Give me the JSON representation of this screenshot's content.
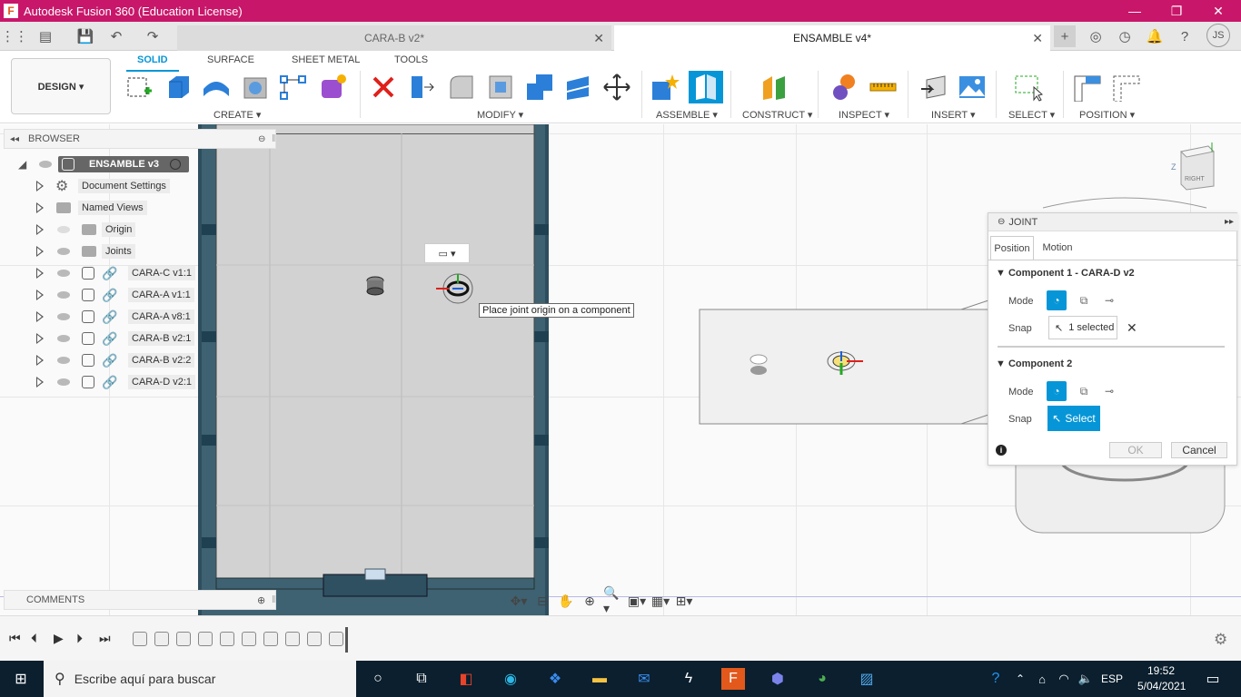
{
  "window": {
    "app_letter": "F",
    "title": "Autodesk Fusion 360 (Education License)"
  },
  "tabs": [
    {
      "label": "CARA-B v2*"
    },
    {
      "label": "ENSAMBLE v4*"
    }
  ],
  "user_initials": "JS",
  "ribbon": {
    "design_label": "DESIGN ▾",
    "tabs": [
      "SOLID",
      "SURFACE",
      "SHEET METAL",
      "TOOLS"
    ],
    "groups": {
      "create": "CREATE ▾",
      "modify": "MODIFY ▾",
      "assemble": "ASSEMBLE ▾",
      "construct": "CONSTRUCT ▾",
      "inspect": "INSPECT ▾",
      "insert": "INSERT ▾",
      "select": "SELECT ▾",
      "position": "POSITION ▾"
    }
  },
  "browser": {
    "title": "BROWSER",
    "root": "ENSAMBLE v3",
    "items": [
      {
        "label": "Document Settings",
        "icon": "gear-icon"
      },
      {
        "label": "Named Views",
        "icon": "folder-icon"
      },
      {
        "label": "Origin",
        "icon": "folder-icon"
      },
      {
        "label": "Joints",
        "icon": "folder-icon"
      },
      {
        "label": "CARA-C v1:1",
        "icon": "link-icon"
      },
      {
        "label": "CARA-A v1:1",
        "icon": "link-icon"
      },
      {
        "label": "CARA-A v8:1",
        "icon": "link-icon"
      },
      {
        "label": "CARA-B v2:1",
        "icon": "link-icon"
      },
      {
        "label": "CARA-B v2:2",
        "icon": "link-icon"
      },
      {
        "label": "CARA-D v2:1",
        "icon": "link-icon"
      }
    ]
  },
  "comments": {
    "title": "COMMENTS"
  },
  "tooltip": "Place joint origin on a component",
  "viewcube": {
    "face": "RIGHT",
    "axis_z": "Z"
  },
  "joint": {
    "title": "JOINT",
    "tabs": [
      "Position",
      "Motion"
    ],
    "component1": {
      "title": "Component 1 - CARA-D v2",
      "mode_label": "Mode",
      "snap_label": "Snap",
      "snap_value": "1 selected"
    },
    "component2": {
      "title": "Component 2",
      "mode_label": "Mode",
      "snap_label": "Snap",
      "snap_value": "Select"
    },
    "ok": "OK",
    "cancel": "Cancel"
  },
  "taskbar": {
    "search_placeholder": "Escribe aquí para buscar",
    "lang": "ESP",
    "time": "19:52",
    "date": "5/04/2021"
  },
  "colors": {
    "titlebar": "#c8176a",
    "accent": "#0696d7",
    "taskbar": "#0b1f2e"
  }
}
